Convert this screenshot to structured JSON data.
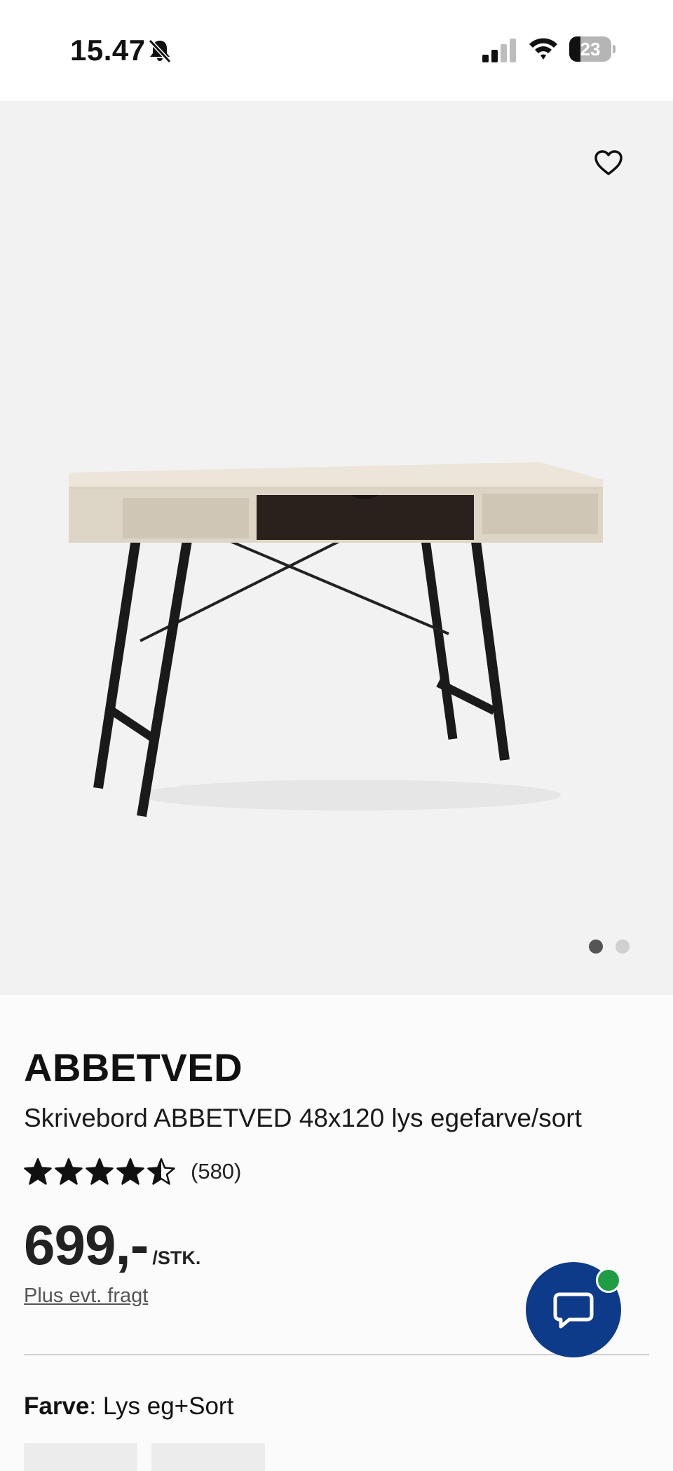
{
  "status_bar": {
    "time": "15.47",
    "battery_level": "23",
    "icons": [
      "bell-slash-icon",
      "signal-icon",
      "wifi-icon",
      "battery-icon"
    ]
  },
  "gallery": {
    "favorite_icon": "heart-outline-icon",
    "image_subject": "desk",
    "page_count": 2,
    "active_page": 1
  },
  "product": {
    "brand": "ABBETVED",
    "name": "Skrivebord ABBETVED 48x120 lys egefarve/sort",
    "rating": 4.5,
    "review_count": "(580)",
    "price": "699,-",
    "unit": "/STK.",
    "shipping_link": "Plus evt. fragt",
    "color_label": "Farve",
    "color_separator": ": ",
    "color_value": "Lys eg+Sort"
  },
  "chat": {
    "icon": "chat-bubble-icon",
    "badge_color": "#1f9d45",
    "button_color": "#0e3a8a"
  }
}
